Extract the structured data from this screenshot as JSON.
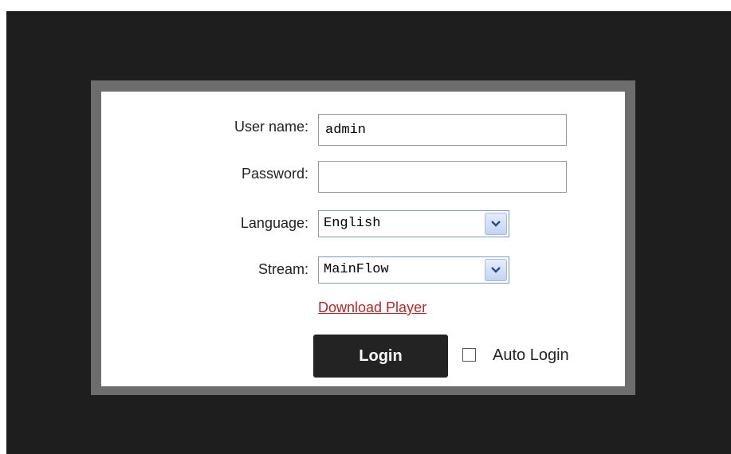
{
  "login_form": {
    "username_label": "User name:",
    "username_value": "admin",
    "password_label": "Password:",
    "password_value": "",
    "language_label": "Language:",
    "language_selected": "English",
    "stream_label": "Stream:",
    "stream_selected": "MainFlow",
    "download_link": "Download Player",
    "login_button": "Login",
    "auto_login_label": "Auto Login",
    "auto_login_checked": false
  },
  "icons": {
    "select_arrow": "chevron-down-icon"
  },
  "colors": {
    "background": "#1e1e1e",
    "panel_border": "#6d6d6d",
    "panel": "#ffffff",
    "link": "#b52828",
    "button": "#232323"
  }
}
